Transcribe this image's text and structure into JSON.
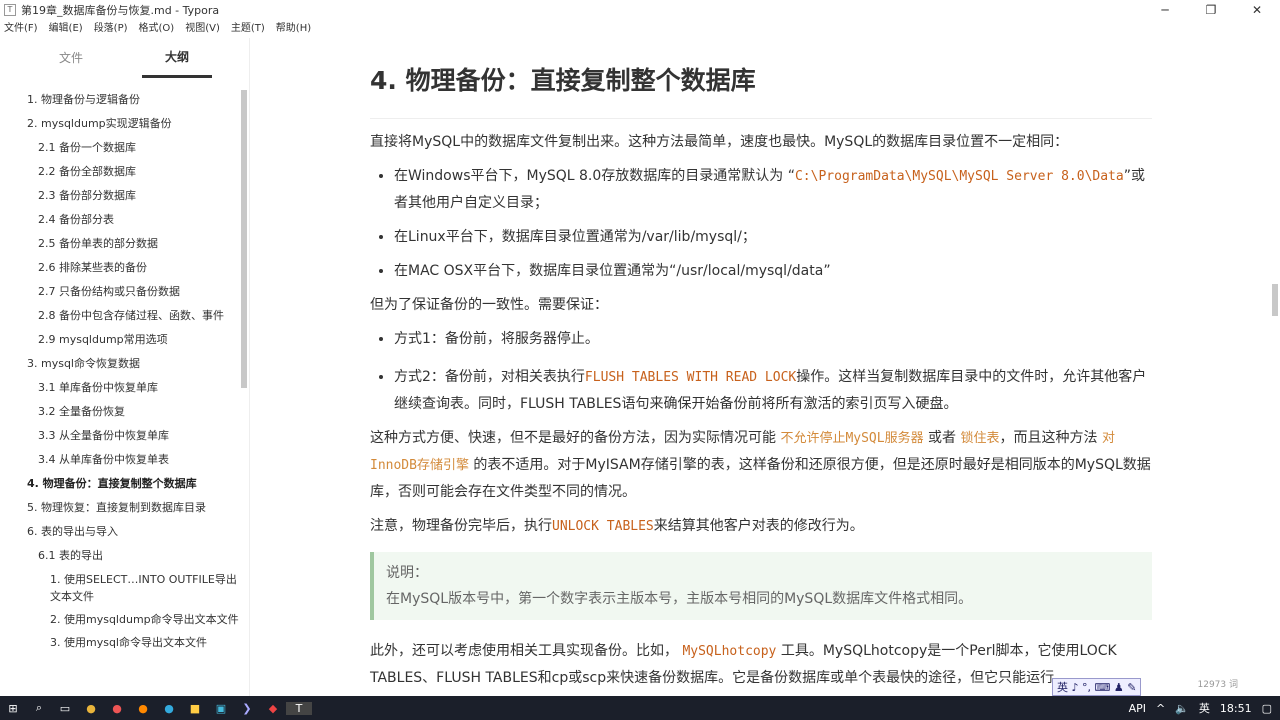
{
  "window": {
    "title": "第19章_数据库备份与恢复.md - Typora",
    "controls": [
      "─",
      "❐",
      "✕"
    ]
  },
  "menu": [
    "文件(F)",
    "编辑(E)",
    "段落(P)",
    "格式(O)",
    "视图(V)",
    "主题(T)",
    "帮助(H)"
  ],
  "sidebar": {
    "tabs": [
      "文件",
      "大纲"
    ],
    "items": [
      {
        "label": "1. 物理备份与逻辑备份",
        "level": 1
      },
      {
        "label": "2. mysqldump实现逻辑备份",
        "level": 1
      },
      {
        "label": "2.1 备份一个数据库",
        "level": 2
      },
      {
        "label": "2.2 备份全部数据库",
        "level": 2
      },
      {
        "label": "2.3 备份部分数据库",
        "level": 2
      },
      {
        "label": "2.4 备份部分表",
        "level": 2
      },
      {
        "label": "2.5 备份单表的部分数据",
        "level": 2
      },
      {
        "label": "2.6 排除某些表的备份",
        "level": 2
      },
      {
        "label": "2.7 只备份结构或只备份数据",
        "level": 2
      },
      {
        "label": "2.8 备份中包含存储过程、函数、事件",
        "level": 2
      },
      {
        "label": "2.9 mysqldump常用选项",
        "level": 2
      },
      {
        "label": "3. mysql命令恢复数据",
        "level": 1
      },
      {
        "label": "3.1 单库备份中恢复单库",
        "level": 2
      },
      {
        "label": "3.2 全量备份恢复",
        "level": 2
      },
      {
        "label": "3.3 从全量备份中恢复单库",
        "level": 2
      },
      {
        "label": "3.4 从单库备份中恢复单表",
        "level": 2
      },
      {
        "label": "4. 物理备份：直接复制整个数据库",
        "level": 1,
        "active": true
      },
      {
        "label": "5. 物理恢复：直接复制到数据库目录",
        "level": 1
      },
      {
        "label": "6. 表的导出与导入",
        "level": 1
      },
      {
        "label": "6.1 表的导出",
        "level": 2
      },
      {
        "label": "1. 使用SELECT…INTO OUTFILE导出文本文件",
        "level": 3
      },
      {
        "label": "2. 使用mysqldump命令导出文本文件",
        "level": 3
      },
      {
        "label": "3. 使用mysql命令导出文本文件",
        "level": 3
      }
    ],
    "footer": [
      "‹",
      "</>"
    ]
  },
  "doc": {
    "heading": "4. 物理备份：直接复制整个数据库",
    "p1": "直接将MySQL中的数据库文件复制出来。这种方法最简单，速度也最快。MySQL的数据库目录位置不一定相同：",
    "b1a": "在Windows平台下，MySQL 8.0存放数据库的目录通常默认为 “",
    "b1code": "C:\\ProgramData\\MySQL\\MySQL Server 8.0\\Data",
    "b1b": "”或者其他用户自定义目录；",
    "b2": "在Linux平台下，数据库目录位置通常为/var/lib/mysql/；",
    "b3": "在MAC OSX平台下，数据库目录位置通常为“/usr/local/mysql/data”",
    "p2": "但为了保证备份的一致性。需要保证：",
    "m1": "方式1：备份前，将服务器停止。",
    "m2a": "方式2：备份前，对相关表执行",
    "m2code": "FLUSH TABLES WITH READ LOCK",
    "m2b": "操作。这样当复制数据库目录中的文件时，允许其他客户继续查询表。同时，FLUSH TABLES语句来确保开始备份前将所有激活的索引页写入硬盘。",
    "p3a": "这种方式方便、快速，但不是最好的备份方法，因为实际情况可能",
    "p3h1": "不允许停止MySQL服务器",
    "p3b": "或者",
    "p3h2": "锁住表",
    "p3c": "，而且这种方法",
    "p3h3": "对InnoDB存储引擎",
    "p3d": "的表不适用。对于MyISAM存储引擎的表，这样备份和还原很方便，但是还原时最好是相同版本的MySQL数据库，否则可能会存在文件类型不同的情况。",
    "p4a": "注意，物理备份完毕后，执行",
    "p4code": "UNLOCK TABLES",
    "p4b": "来结算其他客户对表的修改行为。",
    "note_title": "说明：",
    "note_body": "在MySQL版本号中，第一个数字表示主版本号，主版本号相同的MySQL数据库文件格式相同。",
    "p5a": "此外，还可以考虑使用相关工具实现备份。比如，",
    "p5code": "MySQLhotcopy",
    "p5b": "工具。MySQLhotcopy是一个Perl脚本，它使用LOCK TABLES、FLUSH TABLES和cp或scp来快速备份数据库。它是备份数据库或单个表最快的途径，但它只能运行"
  },
  "status": {
    "word_count": "12973 词",
    "ime": "英 ♪ °, ⌨ ♟ ✎"
  },
  "taskbar": {
    "tray": [
      "API",
      "^",
      "英",
      "18:51"
    ]
  }
}
